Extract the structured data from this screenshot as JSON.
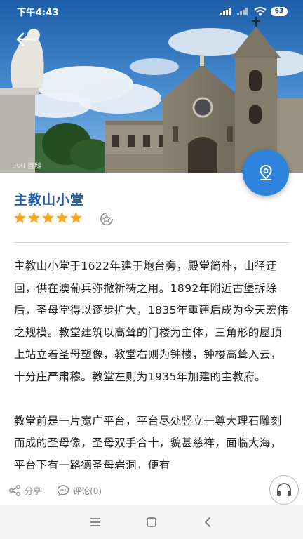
{
  "status_bar": {
    "time": "下午4:43",
    "battery": "63"
  },
  "hero": {
    "watermark": "Bai 百科"
  },
  "place": {
    "title": "主教山小堂",
    "rating_stars": 5
  },
  "content": {
    "paragraph_1": "主教山小堂于1622年建于炮台旁，殿堂简朴，山径迂回，供在澳葡兵弥撒祈祷之用。1892年附近古堡拆除后，圣母堂得以逐步扩大，1835年重建后成为今天宏伟之规模。教堂建筑以高耸的门楼为主体，三角形的屋顶上站立着圣母塑像，教堂右则为钟楼，钟楼高耸入云，十分庄严肃穆。教堂左则为1935年加建的主教府。",
    "paragraph_2": "教堂前是一片宽广平台，平台尽处竖立一尊大理石雕刻而成的圣母像，圣母双手合十，貌甚慈祥，面临大海，平台下有一路德圣母岩洞，便有"
  },
  "actions": {
    "share": "分享",
    "comment": "评论(0)"
  },
  "colors": {
    "accent": "#2d83dc",
    "title": "#1f5aa3",
    "star": "#f5a623"
  },
  "icons": [
    "back-arrow-icon",
    "location-icon",
    "star-icon",
    "rating-badge-icon",
    "share-icon",
    "comment-icon",
    "headphones-icon",
    "menu-icon",
    "home-icon",
    "back-icon"
  ]
}
